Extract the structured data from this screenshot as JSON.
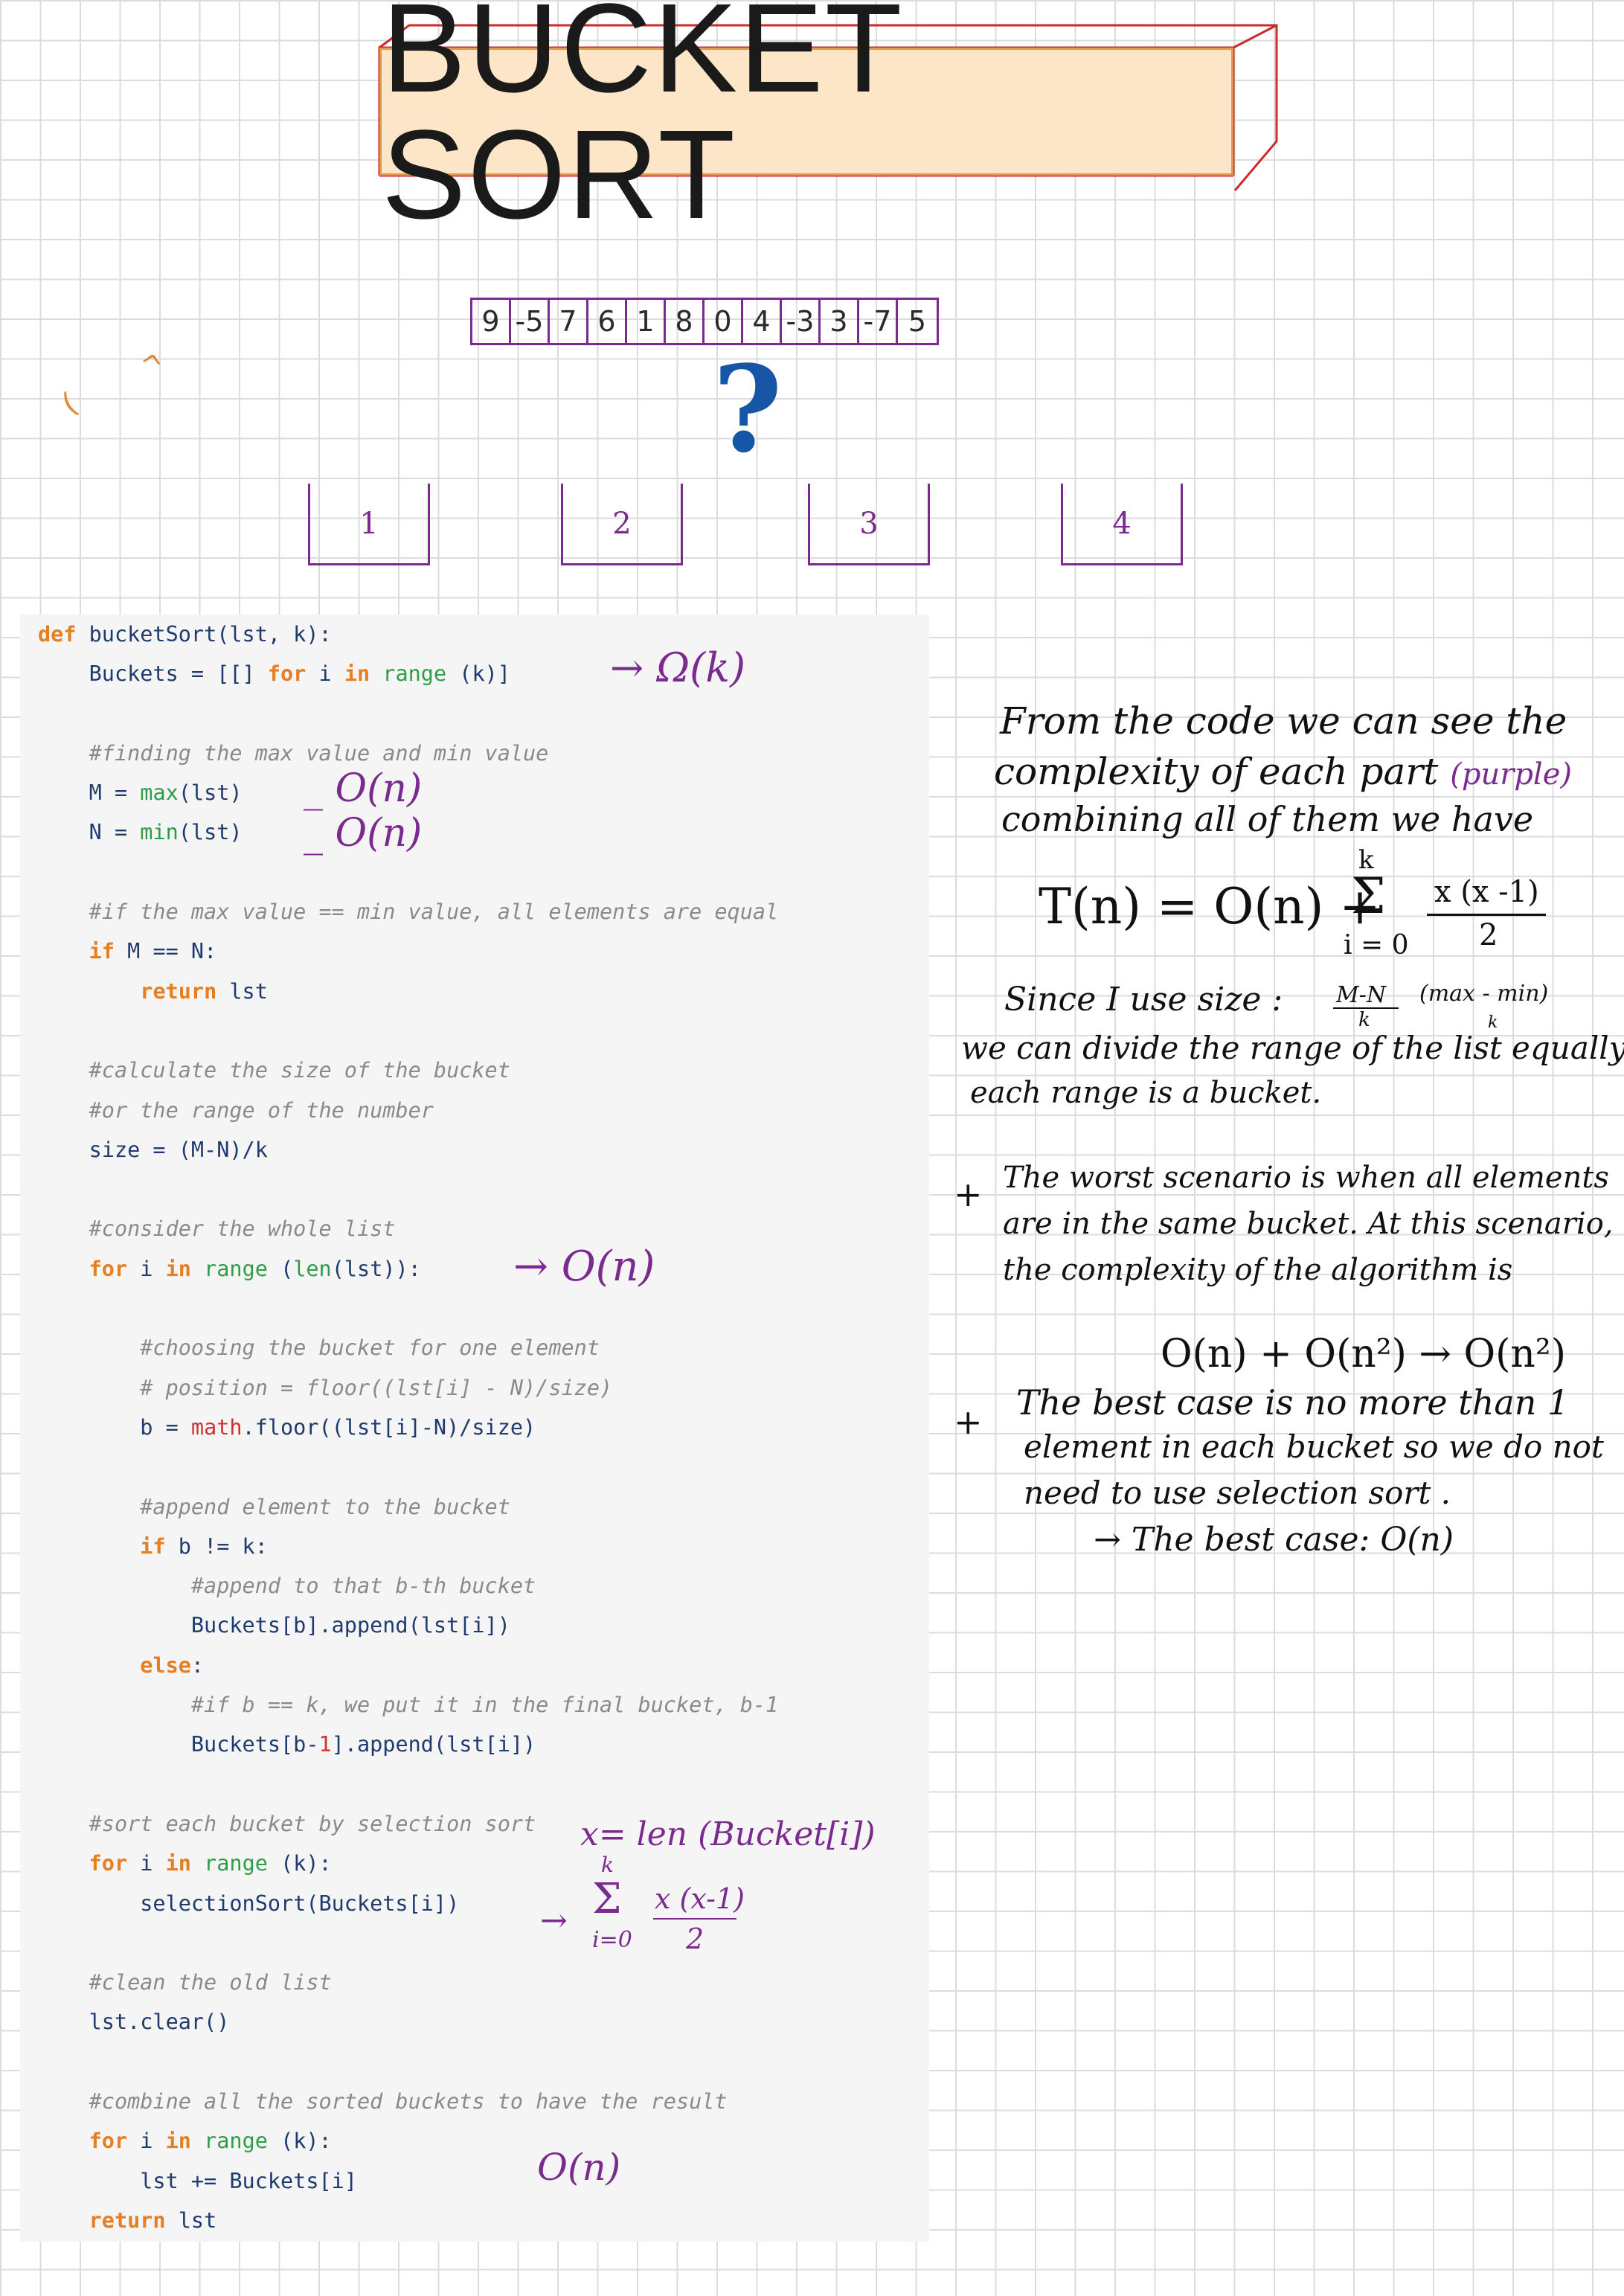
{
  "title": "BUCKET SORT",
  "array": [
    "9",
    "-5",
    "7",
    "6",
    "1",
    "8",
    "0",
    "4",
    "-3",
    "3",
    "-7",
    "5"
  ],
  "question_mark": "?",
  "buckets": [
    "1",
    "2",
    "3",
    "4"
  ],
  "code": [
    [
      {
        "t": "def ",
        "c": "kw"
      },
      {
        "t": "bucketSort(lst, k):"
      }
    ],
    [
      {
        "t": "    Buckets = [[] "
      },
      {
        "t": "for",
        "c": "kw"
      },
      {
        "t": " i "
      },
      {
        "t": "in",
        "c": "kw"
      },
      {
        "t": " "
      },
      {
        "t": "range",
        "c": "bi"
      },
      {
        "t": " (k)]"
      }
    ],
    [],
    [
      {
        "t": "    #finding the max value and min value",
        "c": "cm"
      }
    ],
    [
      {
        "t": "    M = "
      },
      {
        "t": "max",
        "c": "bi"
      },
      {
        "t": "(lst)"
      }
    ],
    [
      {
        "t": "    N = "
      },
      {
        "t": "min",
        "c": "bi"
      },
      {
        "t": "(lst)"
      }
    ],
    [],
    [
      {
        "t": "    #if the max value == min value, all elements are equal",
        "c": "cm"
      }
    ],
    [
      {
        "t": "    "
      },
      {
        "t": "if",
        "c": "kw"
      },
      {
        "t": " M == N:"
      }
    ],
    [
      {
        "t": "        "
      },
      {
        "t": "return",
        "c": "kw"
      },
      {
        "t": " lst"
      }
    ],
    [],
    [
      {
        "t": "    #calculate the size of the bucket",
        "c": "cm"
      }
    ],
    [
      {
        "t": "    #or the range of the number",
        "c": "cm"
      }
    ],
    [
      {
        "t": "    size = (M-N)/k"
      }
    ],
    [],
    [
      {
        "t": "    #consider the whole list",
        "c": "cm"
      }
    ],
    [
      {
        "t": "    "
      },
      {
        "t": "for",
        "c": "kw"
      },
      {
        "t": " i "
      },
      {
        "t": "in",
        "c": "kw"
      },
      {
        "t": " "
      },
      {
        "t": "range",
        "c": "bi"
      },
      {
        "t": " ("
      },
      {
        "t": "len",
        "c": "bi"
      },
      {
        "t": "(lst)):"
      }
    ],
    [],
    [
      {
        "t": "        #choosing the bucket for one element",
        "c": "cm"
      }
    ],
    [
      {
        "t": "        # position = floor((lst[i] - N)/size)",
        "c": "cm"
      }
    ],
    [
      {
        "t": "        b = "
      },
      {
        "t": "math",
        "c": "fn"
      },
      {
        "t": ".floor((lst[i]-N)/size)"
      }
    ],
    [],
    [
      {
        "t": "        #append element to the bucket",
        "c": "cm"
      }
    ],
    [
      {
        "t": "        "
      },
      {
        "t": "if",
        "c": "kw"
      },
      {
        "t": " b != k:"
      }
    ],
    [
      {
        "t": "            #append to that b-th bucket",
        "c": "cm"
      }
    ],
    [
      {
        "t": "            Buckets[b].append(lst[i])"
      }
    ],
    [
      {
        "t": "        "
      },
      {
        "t": "else",
        "c": "kw"
      },
      {
        "t": ":"
      }
    ],
    [
      {
        "t": "            #if b == k, we put it in the final bucket, b-1",
        "c": "cm"
      }
    ],
    [
      {
        "t": "            Buckets[b-"
      },
      {
        "t": "1",
        "c": "nm"
      },
      {
        "t": "].append(lst[i])"
      }
    ],
    [],
    [
      {
        "t": "    #sort each bucket by selection sort",
        "c": "cm"
      }
    ],
    [
      {
        "t": "    "
      },
      {
        "t": "for",
        "c": "kw"
      },
      {
        "t": " i "
      },
      {
        "t": "in",
        "c": "kw"
      },
      {
        "t": " "
      },
      {
        "t": "range",
        "c": "bi"
      },
      {
        "t": " (k):"
      }
    ],
    [
      {
        "t": "        selectionSort(Buckets[i])"
      }
    ],
    [],
    [
      {
        "t": "    #clean the old list",
        "c": "cm"
      }
    ],
    [
      {
        "t": "    lst.clear()"
      }
    ],
    [],
    [
      {
        "t": "    #combine all the sorted buckets to have the result",
        "c": "cm"
      }
    ],
    [
      {
        "t": "    "
      },
      {
        "t": "for",
        "c": "kw"
      },
      {
        "t": " i "
      },
      {
        "t": "in",
        "c": "kw"
      },
      {
        "t": " "
      },
      {
        "t": "range",
        "c": "bi"
      },
      {
        "t": " (k):"
      }
    ],
    [
      {
        "t": "        lst += Buckets[i]"
      }
    ],
    [
      {
        "t": "    "
      },
      {
        "t": "return",
        "c": "kw"
      },
      {
        "t": " lst"
      }
    ]
  ],
  "annotations": {
    "omega_k": "→  Ω(k)",
    "on_max": "_ O(n)",
    "on_min": "_ O(n)",
    "on_loop": "→  O(n)",
    "x_def": "x= len (Bucket[i])",
    "sum_arrow": "→",
    "sum_upper": "k",
    "sum_symbol": "Σ",
    "sum_lower": "i=0",
    "sum_numer": "x (x-1)",
    "sum_denom": "2",
    "on_combine": "O(n)"
  },
  "notes": {
    "line1": "From the code we can see the",
    "line2a": "complexity of each part ",
    "line2b": "(purple)",
    "line3": "combining all of them we have",
    "formula_left": "T(n) = O(n) +",
    "formula_upper": "k",
    "formula_sigma": "Σ",
    "formula_lower": "i = 0",
    "formula_numer": "x (x -1)",
    "formula_denom": "2",
    "since_a": "Since  I use  size :",
    "since_frac_num": "M-N",
    "since_frac_den": "k",
    "since_paren": "(max - min)",
    "since_paren_den": "k",
    "since2": "we can divide the range of the list equally",
    "since3": "each range is a bucket.",
    "worst_bullet": "+",
    "worst1": "The worst scenario is when all elements",
    "worst2": "are in the same bucket. At this scenario,",
    "worst3": "the complexity of the algorithm is",
    "worst_formula": "O(n)  +  O(n²)  →  O(n²)",
    "best_bullet": "+",
    "best1": "The best case is no more than 1",
    "best2": "element in each bucket so we do not",
    "best3": "need to use selection sort .",
    "best4": "→  The best case:   O(n)"
  },
  "colors": {
    "annotation": "#7b2a8e",
    "question": "#1756a6",
    "title_fill": "#fde5c8",
    "title_3d": "#cc2b2b"
  }
}
